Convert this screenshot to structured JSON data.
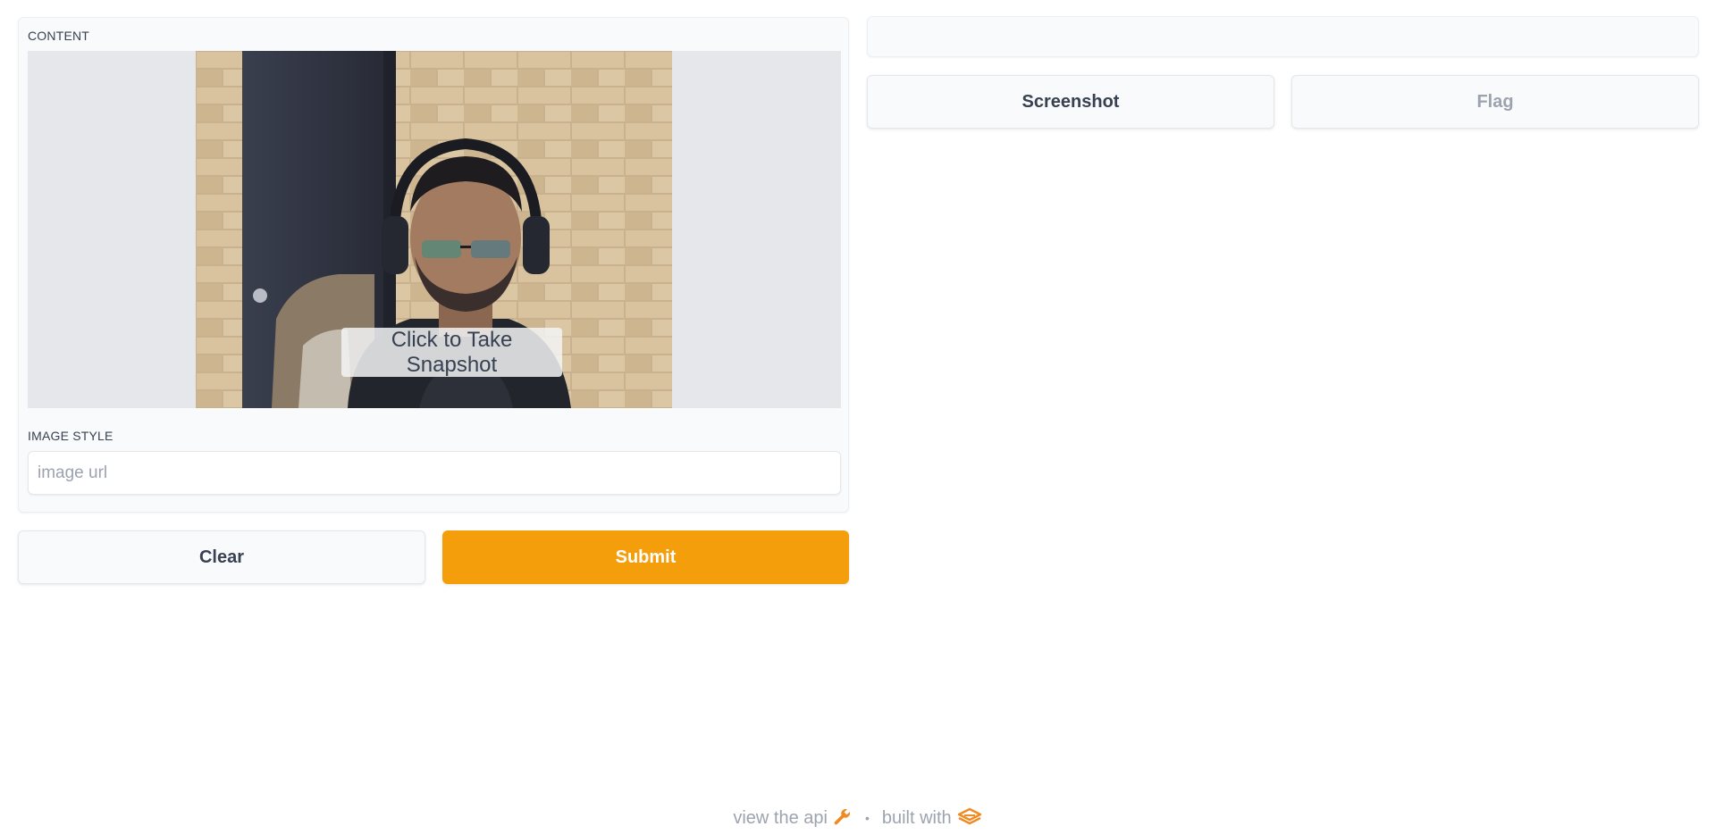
{
  "input_panel": {
    "content_label": "CONTENT",
    "snapshot_label": "Click to Take Snapshot",
    "style_label": "IMAGE STYLE",
    "style_placeholder": "image url",
    "style_value": ""
  },
  "actions": {
    "clear_label": "Clear",
    "submit_label": "Submit"
  },
  "output_panel": {
    "screenshot_label": "Screenshot",
    "flag_label": "Flag"
  },
  "footer": {
    "api_label": "view the api",
    "separator": "•",
    "built_with_label": "built with",
    "api_icon": "wrench-icon",
    "logo_icon": "gradio-logo-icon"
  },
  "colors": {
    "accent": "#f59e0b",
    "panel_bg": "#f9fafb",
    "webcam_bg": "#e5e7eb"
  }
}
